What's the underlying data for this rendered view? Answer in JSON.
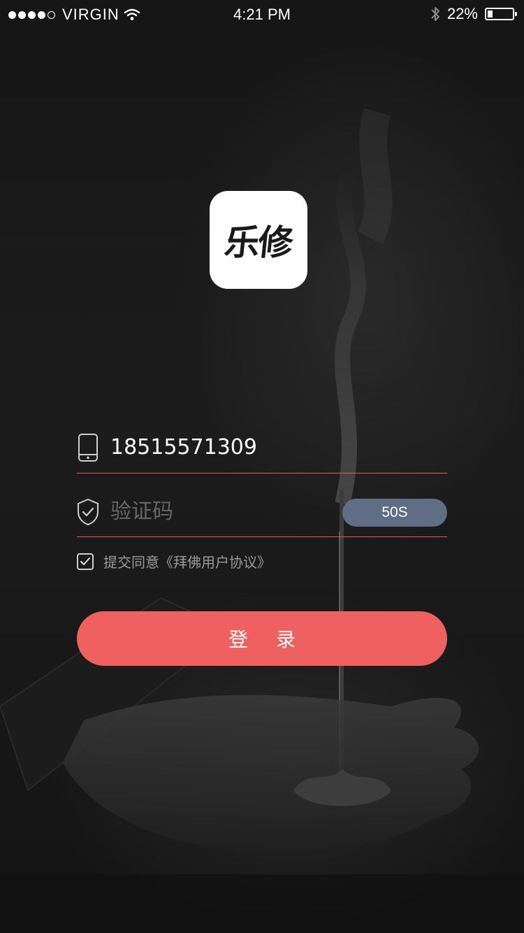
{
  "status_bar": {
    "carrier": "VIRGIN",
    "time": "4:21 PM",
    "battery_text": "22%",
    "battery_level": 0.22,
    "signal_bars_filled": 4,
    "signal_bars_total": 5,
    "icons": [
      "signal-icon",
      "wifi-icon",
      "bluetooth-icon",
      "battery-icon"
    ]
  },
  "logo": {
    "text": "乐修"
  },
  "form": {
    "phone": {
      "value": "18515571309",
      "icon": "phone-icon"
    },
    "code": {
      "value": "",
      "placeholder": "验证码",
      "icon": "shield-check-icon",
      "button_label": "50S"
    },
    "agreement": {
      "checked": true,
      "text": "提交同意《拜佛用户协议》"
    },
    "login_label": "登录"
  },
  "colors": {
    "accent": "#ef6161",
    "code_button": "#5f6e84",
    "underline": "#e05a5a",
    "background": "#1a1a1a"
  }
}
